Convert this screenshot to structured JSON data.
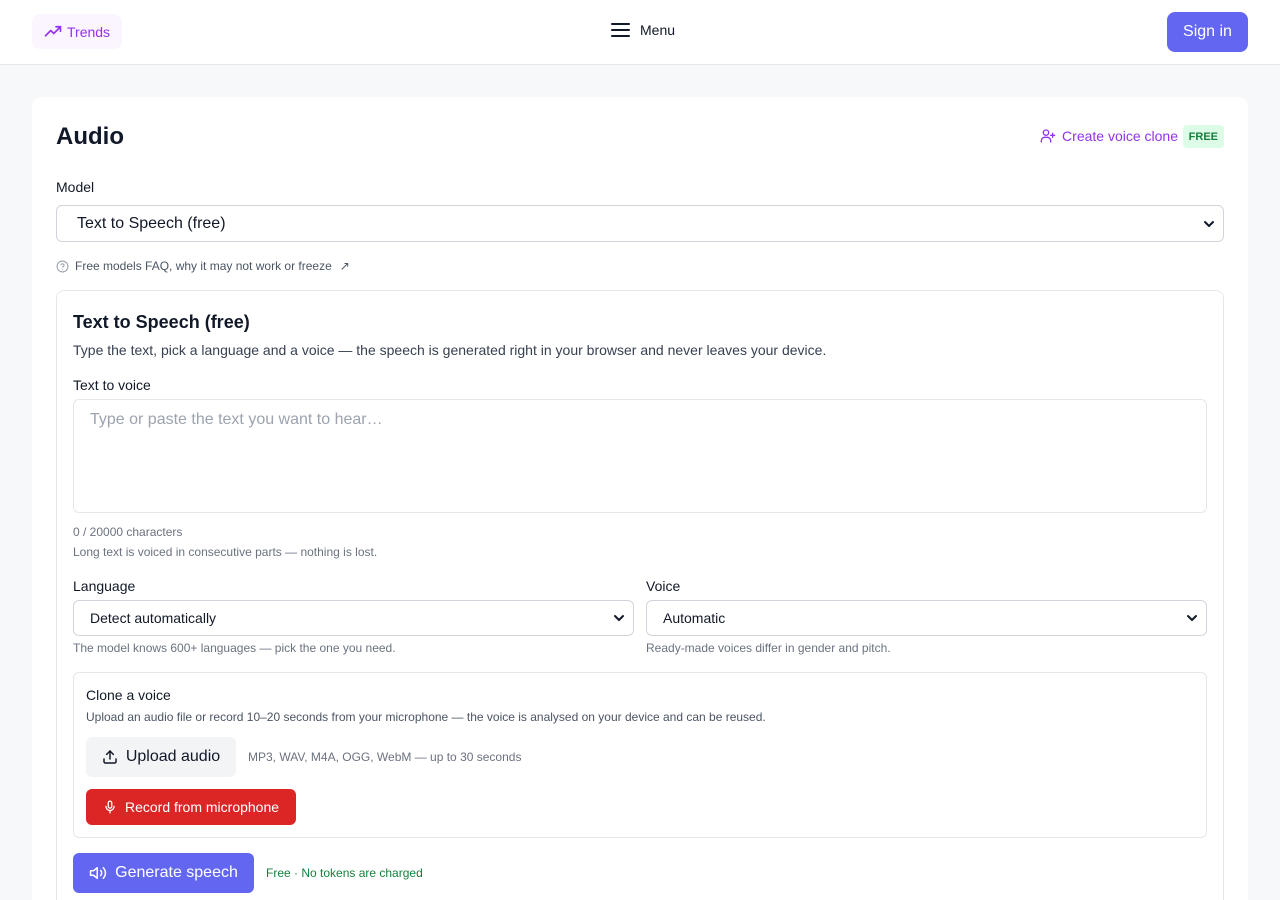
{
  "header": {
    "trends_label": "Trends",
    "menu_label": "Menu",
    "signin_label": "Sign in"
  },
  "page": {
    "title": "Audio",
    "create_clone_label": "Create voice clone",
    "free_badge": "FREE",
    "model_label": "Model",
    "model_selected": "Text to Speech (free)",
    "faq_label": "Free models FAQ, why it may not work or freeze",
    "faq_arrow": "↗"
  },
  "panel": {
    "title": "Text to Speech (free)",
    "description": "Type the text, pick a language and a voice — the speech is generated right in your browser and never leaves your device.",
    "text_label": "Text to voice",
    "text_placeholder": "Type or paste the text you want to hear…",
    "char_count": "0 / 20000 characters",
    "long_text_hint": "Long text is voiced in consecutive parts — nothing is lost.",
    "language_label": "Language",
    "language_selected": "Detect automatically",
    "language_hint": "The model knows 600+ languages — pick the one you need.",
    "voice_label": "Voice",
    "voice_selected": "Automatic",
    "voice_hint": "Ready-made voices differ in gender and pitch."
  },
  "clone": {
    "title": "Clone a voice",
    "description": "Upload an audio file or record 10–20 seconds from your microphone — the voice is analysed on your device and can be reused.",
    "upload_label": "Upload audio",
    "upload_hint": "MP3, WAV, M4A, OGG, WebM — up to 30 seconds",
    "record_label": "Record from microphone"
  },
  "generate": {
    "label": "Generate speech",
    "note": "Free · No tokens are charged"
  },
  "icons": {
    "trends": "trending-up-icon",
    "menu": "hamburger-menu-icon",
    "clone": "user-plus-icon",
    "faq": "help-circle-icon",
    "chevron": "chevron-down-icon",
    "upload": "upload-icon",
    "mic": "microphone-icon",
    "speaker": "speaker-icon"
  },
  "colors": {
    "accent": "#6366f1",
    "purple_link": "#9333ea",
    "record_red": "#dc2626",
    "free_green": "#15803d",
    "badge_bg": "#dcfce7"
  }
}
